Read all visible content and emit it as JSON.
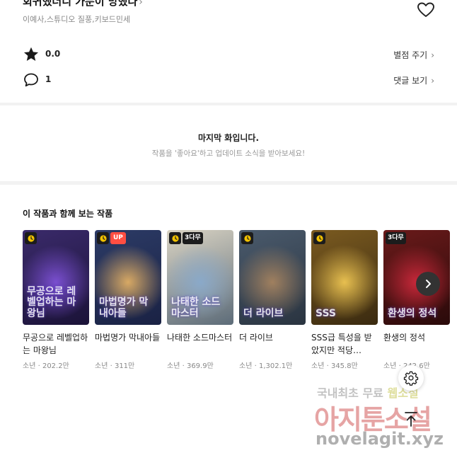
{
  "header": {
    "title": "회귀했더니 가문이 망했다",
    "title_chevron": "›",
    "authors": "이예사,스튜디오 질풍,키보드민세",
    "favorite_icon": "heart-icon"
  },
  "stats": {
    "rating_value": "0.0",
    "rating_link": "별점 주기",
    "comment_count": "1",
    "comment_link": "댓글 보기",
    "chevron": "›"
  },
  "last_episode": {
    "title": "마지막 화입니다.",
    "subtitle": "작품을 '좋아요'하고 업데이트 소식을 받아보세요!"
  },
  "recommendations": {
    "title": "이 작품과 함께 보는 작품",
    "items": [
      {
        "name": "무공으로 레벨업하는 마왕님",
        "genre": "소년",
        "views": "202.2만",
        "badges": [
          "clock"
        ],
        "art_text": "무공으로 레벨업하는 마왕님",
        "colors": [
          "#3a2a6a",
          "#7a4fd0",
          "#1b1338"
        ]
      },
      {
        "name": "마법명가 막내아들",
        "genre": "소년",
        "views": "311만",
        "badges": [
          "clock",
          "UP"
        ],
        "art_text": "마법명가 막내아들",
        "colors": [
          "#2c3b66",
          "#d8a964",
          "#1a2244"
        ]
      },
      {
        "name": "나태한 소드마스터",
        "genre": "소년",
        "views": "369.9만",
        "badges": [
          "clock",
          "3다무"
        ],
        "art_text": "나태한 소드마스터",
        "colors": [
          "#d9d3c3",
          "#8aa9c9",
          "#5d6c79"
        ]
      },
      {
        "name": "더 라이브",
        "genre": "소년",
        "views": "1,302.1만",
        "badges": [
          "clock"
        ],
        "art_text": "더 라이브",
        "colors": [
          "#4a5a6c",
          "#a0805f",
          "#2a3440"
        ]
      },
      {
        "name": "SSS급 특성을 받았지만 적당…",
        "genre": "소년",
        "views": "345.8만",
        "badges": [
          "clock"
        ],
        "art_text": "SSS",
        "colors": [
          "#7a5a20",
          "#e8c050",
          "#3a2a10"
        ]
      },
      {
        "name": "환생의 정석",
        "genre": "소년",
        "views": "242.6만",
        "badges": [
          "3다무"
        ],
        "art_text": "환생의 정석",
        "colors": [
          "#6a1a1a",
          "#c8283a",
          "#2a0a0a"
        ]
      }
    ],
    "meta_separator": " · "
  },
  "watermark": {
    "line1_a": "국내최초 무료 ",
    "line1_b": "웹소설",
    "line2": "아지툰소설",
    "line3": "novelagit.xyz"
  },
  "colors": {
    "background": "#ffffff",
    "section_gap": "#f2f2f2",
    "up_badge": "#ff4e42"
  }
}
